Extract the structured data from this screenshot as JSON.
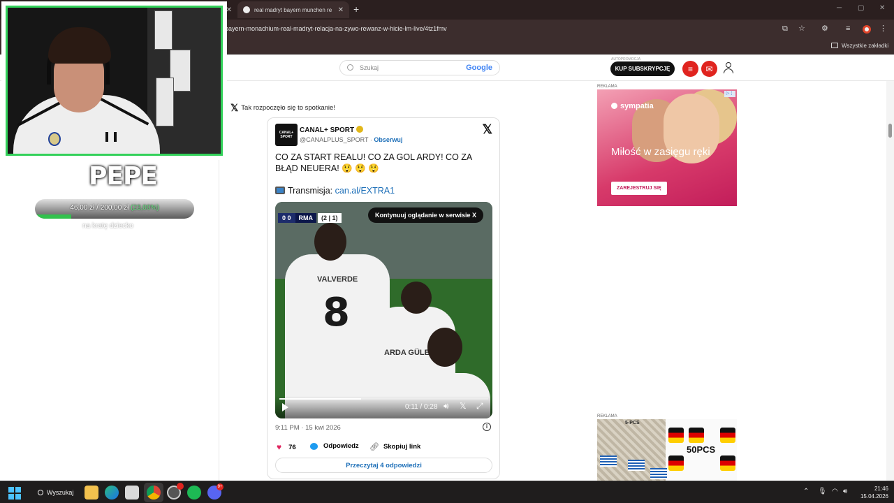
{
  "browser": {
    "tabs": [
      {
        "title": "",
        "active": false
      },
      {
        "title": "real madryt bayern munchen re",
        "active": true
      }
    ],
    "new_tab": "+",
    "url": "bayern-monachium-real-madryt-relacja-na-zywo-rewanz-w-hicie-lm-live/4tz1fmv",
    "bookmarks_label": "Wszystkie zakładki"
  },
  "header": {
    "search_placeholder": "Szukaj",
    "search_provider": "Google",
    "ad_caption": "AUTOPROMOCJA",
    "subscribe_label": "KUP SUBSKRYPCJĘ"
  },
  "article": {
    "x_intro": "Tak rozpoczęło się to spotkanie!"
  },
  "tweet": {
    "author_name": "CANAL+ SPORT",
    "avatar_text": "CANAL+ SPORT",
    "handle": "@CANALPLUS_SPORT",
    "separator": " · ",
    "follow_label": "Obserwuj",
    "text": "CO ZA START REALU! CO ZA GOL ARDY! CO ZA BŁĄD NEUERA! 😲 😲 😲",
    "broadcast_label": "Transmisja:",
    "broadcast_link": "can.al/EXTRA1",
    "video": {
      "score": "0   0",
      "team": "RMA",
      "aggregate": "(2 | 1)",
      "continue_label": "Kontynuuj oglądanie w serwisie X",
      "time": "0:11 / 0:28",
      "progress": 0.39,
      "shirt_number": "8",
      "shirt_name_1": "VALVERDE",
      "shirt_name_2": "ARDA GÜLER"
    },
    "timestamp": "9:11 PM · 15 kwi 2026",
    "likes": "76",
    "reply_label": "Odpowiedz",
    "copy_label": "Skopiuj link",
    "read_replies": "Przeczytaj 4 odpowiedzi"
  },
  "ads": {
    "label_1": "REKLAMA",
    "brand": "sympatia",
    "slogan": "Miłość w zasięgu ręki",
    "cta": "ZAREJESTRUJ SIĘ",
    "label_2": "REKLAMA",
    "pcs_text": "5-PCS",
    "big_text": "50PCS"
  },
  "stream_overlay": {
    "name": "PEPE",
    "donation_current": "46,00 zł",
    "donation_sep": " / ",
    "donation_goal": "200,00 zł",
    "donation_percent": "(23,00%)",
    "donation_fraction": 0.23,
    "caption": "na kratę dziecko"
  },
  "taskbar": {
    "search_label": "Wyszukaj",
    "discord_badge": "9+",
    "time": "21:46",
    "date": "15.04.2026"
  },
  "colors": {
    "accent_green": "#33d15a",
    "brand_red": "#e0241f",
    "link_blue": "#1d6fb8"
  }
}
